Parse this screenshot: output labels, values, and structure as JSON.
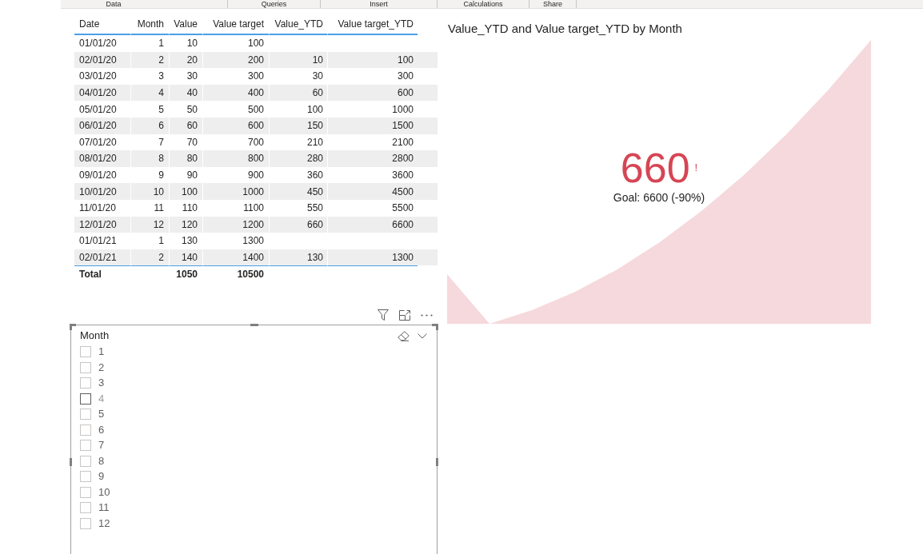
{
  "ribbon": {
    "groups": [
      "Data",
      "Queries",
      "Insert",
      "Calculations",
      "Share"
    ]
  },
  "table": {
    "columns": [
      "Date",
      "Month",
      "Value",
      "Value target",
      "Value_YTD",
      "Value target_YTD"
    ],
    "rows": [
      [
        "01/01/20",
        "1",
        "10",
        "100",
        null,
        null
      ],
      [
        "02/01/20",
        "2",
        "20",
        "200",
        "10",
        "100"
      ],
      [
        "03/01/20",
        "3",
        "30",
        "300",
        "30",
        "300"
      ],
      [
        "04/01/20",
        "4",
        "40",
        "400",
        "60",
        "600"
      ],
      [
        "05/01/20",
        "5",
        "50",
        "500",
        "100",
        "1000"
      ],
      [
        "06/01/20",
        "6",
        "60",
        "600",
        "150",
        "1500"
      ],
      [
        "07/01/20",
        "7",
        "70",
        "700",
        "210",
        "2100"
      ],
      [
        "08/01/20",
        "8",
        "80",
        "800",
        "280",
        "2800"
      ],
      [
        "09/01/20",
        "9",
        "90",
        "900",
        "360",
        "3600"
      ],
      [
        "10/01/20",
        "10",
        "100",
        "1000",
        "450",
        "4500"
      ],
      [
        "11/01/20",
        "11",
        "110",
        "1100",
        "550",
        "5500"
      ],
      [
        "12/01/20",
        "12",
        "120",
        "1200",
        "660",
        "6600"
      ],
      [
        "01/01/21",
        "1",
        "130",
        "1300",
        null,
        null
      ],
      [
        "02/01/21",
        "2",
        "140",
        "1400",
        "130",
        "1300"
      ]
    ],
    "total": {
      "label": "Total",
      "value": "1050",
      "value_target": "10500"
    }
  },
  "slicer": {
    "title": "Month",
    "items": [
      {
        "label": "1",
        "checked": false,
        "hovered": false
      },
      {
        "label": "2",
        "checked": false,
        "hovered": false
      },
      {
        "label": "3",
        "checked": false,
        "hovered": false
      },
      {
        "label": "4",
        "checked": false,
        "hovered": true
      },
      {
        "label": "5",
        "checked": false,
        "hovered": false
      },
      {
        "label": "6",
        "checked": false,
        "hovered": false
      },
      {
        "label": "7",
        "checked": false,
        "hovered": false
      },
      {
        "label": "8",
        "checked": false,
        "hovered": false
      },
      {
        "label": "9",
        "checked": false,
        "hovered": false
      },
      {
        "label": "10",
        "checked": false,
        "hovered": false
      },
      {
        "label": "11",
        "checked": false,
        "hovered": false
      },
      {
        "label": "12",
        "checked": false,
        "hovered": false
      }
    ]
  },
  "kpi": {
    "title": "Value_YTD and Value target_YTD by Month",
    "value": "660",
    "below_goal": true,
    "status_icon": "!",
    "goal": "Goal: 6600 (-90%)"
  }
}
